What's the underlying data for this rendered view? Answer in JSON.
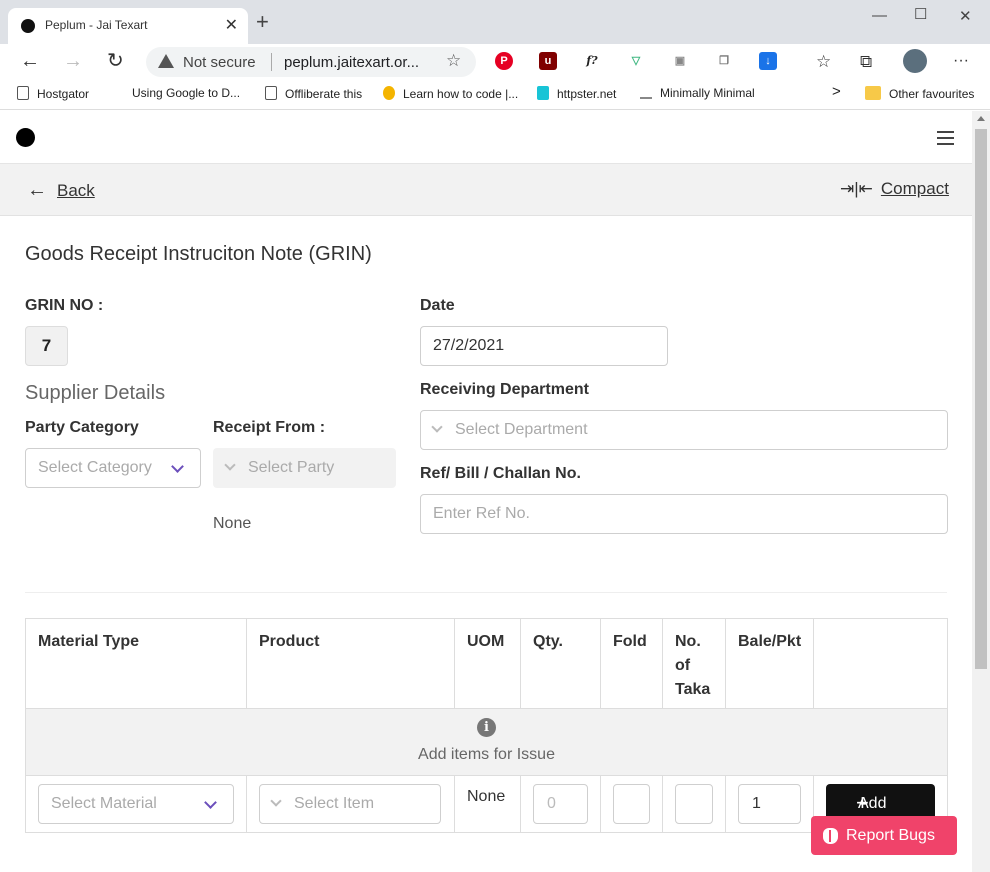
{
  "browser": {
    "tab_title": "Peplum - Jai Texart",
    "close_glyph": "✕",
    "newtab_glyph": "+",
    "not_secure": "Not secure",
    "url": "peplum.jaitexart.or...",
    "bookmarks": [
      "Hostgator",
      "Using Google to D...",
      "Offliberate this",
      "Learn how to code |...",
      "httpster.net",
      "Minimally Minimal",
      "Other favourites"
    ],
    "extension_icons": [
      "pinterest-icon",
      "ublock-icon",
      "whatfont-icon",
      "vue-devtools-icon",
      "cast-icon",
      "copy-icon",
      "download-icon"
    ]
  },
  "header": {
    "back_label": "Back",
    "compact_label": "Compact"
  },
  "form": {
    "title": "Goods Receipt Instruciton Note (GRIN)",
    "grin_no_label": "GRIN NO :",
    "grin_no_value": "7",
    "date_label": "Date",
    "date_value": "27/2/2021",
    "supplier_section": "Supplier Details",
    "party_category_label": "Party Category",
    "party_category_placeholder": "Select Category",
    "receipt_from_label": "Receipt From :",
    "receipt_from_placeholder": "Select Party",
    "receipt_from_none": "None",
    "receiving_dept_label": "Receiving Department",
    "receiving_dept_placeholder": "Select Department",
    "ref_label": "Ref/ Bill / Challan No.",
    "ref_placeholder": "Enter Ref No."
  },
  "table": {
    "headers": [
      "Material Type",
      "Product",
      "UOM",
      "Qty.",
      "Fold",
      "No. of Taka",
      "Bale/Pkt"
    ],
    "empty_message": "Add items for Issue",
    "row": {
      "material_placeholder": "Select Material",
      "item_placeholder": "Select Item",
      "uom": "None",
      "qty_placeholder": "0",
      "bale_value": "1",
      "add_label": "Add"
    }
  },
  "report_bugs_label": "Report Bugs",
  "colors": {
    "accent": "#6b4fbb",
    "report": "#f0436a",
    "add_button": "#111111"
  }
}
